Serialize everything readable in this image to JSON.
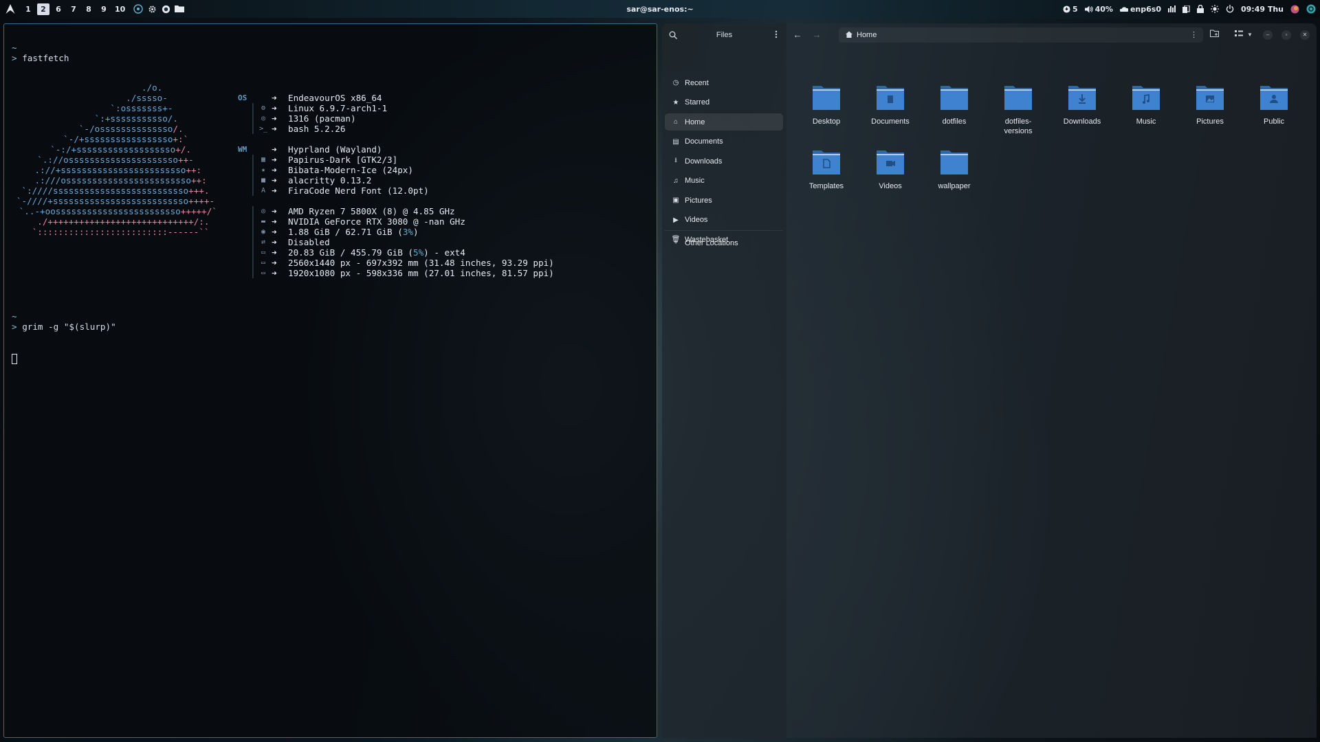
{
  "topbar": {
    "workspaces": [
      "1",
      "2",
      "6",
      "7",
      "8",
      "9",
      "10"
    ],
    "active_workspace": "2",
    "title": "sar@sar-enos:~",
    "updates": "5",
    "volume": "40%",
    "network": "enp6s0",
    "clock": "09:49 Thu"
  },
  "terminal": {
    "tilde1": "~",
    "prompt_symbol": ">",
    "cmd1": "fastfetch",
    "ascii_art": [
      "              ./o.",
      "            ./sssso-",
      "          `:osssssss+-",
      "        `:+sssssssssso/.",
      "      `-/ossssssssssssso/.",
      "    `-/+sssssssssssssssso+:`",
      "  `-:/+sssssssssssssssssso+/.",
      "`.://osssssssssssssssssssso++-",
      " .://+ssssssssssssssssssssssso++:",
      "  .:///ossssssssssssssssssssssso++:",
      "`:////ssssssssssssssssssssssssso+++.",
      "`-////+ssssssssssssssssssssssssso++++-",
      " `..-+oossssssssssssssssssssssso+++++/`",
      "   ./++++++++++++++++++++++++++++/:.",
      "  `:::::::::::::::::::::::::------``"
    ],
    "info": [
      {
        "key": "OS",
        "icon": "",
        "value": "EndeavourOS x86_64"
      },
      {
        "key": "",
        "icon": "⚙",
        "value": "Linux 6.9.7-arch1-1"
      },
      {
        "key": "",
        "icon": "◎",
        "value": "1316 (pacman)"
      },
      {
        "key": "",
        "icon": ">_",
        "value": "bash 5.2.26"
      },
      {
        "key": "",
        "icon": "",
        "value": ""
      },
      {
        "key": "WM",
        "icon": "",
        "value": "Hyprland (Wayland)"
      },
      {
        "key": "",
        "icon": "▦",
        "value": "Papirus-Dark [GTK2/3]"
      },
      {
        "key": "",
        "icon": "★",
        "value": "Bibata-Modern-Ice (24px)"
      },
      {
        "key": "",
        "icon": "■",
        "value": "alacritty 0.13.2"
      },
      {
        "key": "",
        "icon": "A",
        "value": "FiraCode Nerd Font (12.0pt)"
      },
      {
        "key": "",
        "icon": "",
        "value": ""
      },
      {
        "key": "",
        "icon": "◎",
        "value": "AMD Ryzen 7 5800X (8) @ 4.85 GHz"
      },
      {
        "key": "",
        "icon": "▬",
        "value": "NVIDIA GeForce RTX 3080 @ -nan GHz"
      },
      {
        "key": "",
        "icon": "◉",
        "value": "1.88 GiB / 62.71 GiB (",
        "pct": "3%",
        "tail": ")"
      },
      {
        "key": "",
        "icon": "⇄",
        "value": "Disabled"
      },
      {
        "key": "",
        "icon": "▭",
        "value": "20.83 GiB / 455.79 GiB (",
        "pct": "5%",
        "tail": ") - ext4"
      },
      {
        "key": "",
        "icon": "▭",
        "value": "2560x1440 px - 697x392 mm (31.48 inches, 93.29 ppi)"
      },
      {
        "key": "",
        "icon": "▭",
        "value": "1920x1080 px - 598x336 mm (27.01 inches, 81.57 ppi)"
      }
    ],
    "tilde2": "~",
    "cmd2": "grim -g \"$(slurp)\""
  },
  "files": {
    "title": "Files",
    "sidebar": [
      {
        "label": "Recent",
        "icon": "◷"
      },
      {
        "label": "Starred",
        "icon": "★"
      },
      {
        "label": "Home",
        "icon": "⌂"
      },
      {
        "label": "Documents",
        "icon": "▤"
      },
      {
        "label": "Downloads",
        "icon": "⭳"
      },
      {
        "label": "Music",
        "icon": "♫"
      },
      {
        "label": "Pictures",
        "icon": "▣"
      },
      {
        "label": "Videos",
        "icon": "▶"
      },
      {
        "label": "Wastebasket",
        "icon": "🗑"
      }
    ],
    "other_locations": "Other Locations",
    "path": "Home",
    "folders": [
      {
        "label": "Desktop",
        "emblem": ""
      },
      {
        "label": "Documents",
        "emblem": "doc"
      },
      {
        "label": "dotfiles",
        "emblem": ""
      },
      {
        "label": "dotfiles-\nversions",
        "emblem": ""
      },
      {
        "label": "Downloads",
        "emblem": "down"
      },
      {
        "label": "Music",
        "emblem": "music"
      },
      {
        "label": "Pictures",
        "emblem": "pic"
      },
      {
        "label": "Public",
        "emblem": "user"
      },
      {
        "label": "Templates",
        "emblem": "tmpl"
      },
      {
        "label": "Videos",
        "emblem": "video"
      },
      {
        "label": "wallpaper",
        "emblem": ""
      }
    ]
  }
}
